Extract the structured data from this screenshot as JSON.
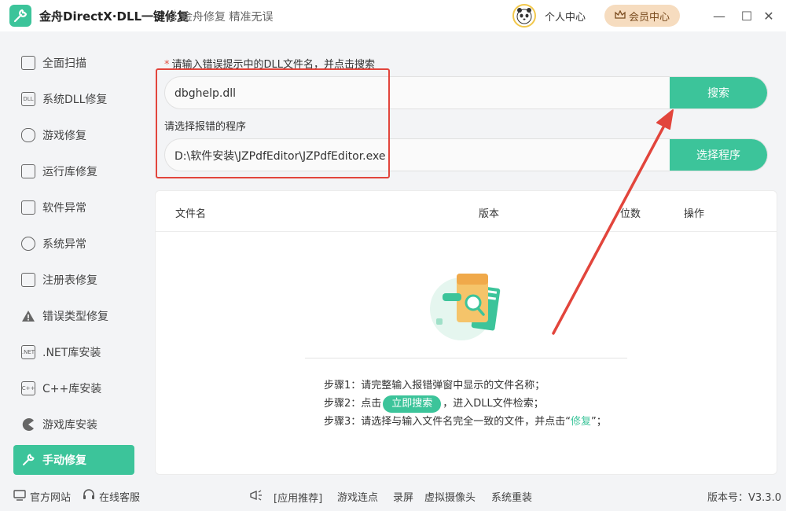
{
  "titlebar": {
    "title": "金舟DirectX·DLL一键修复",
    "slogan": "金舟修复 精准无误",
    "personal_center": "个人中心",
    "vip_center": "会员中心",
    "minimize": "—",
    "maximize": "☐",
    "close": "✕"
  },
  "sidebar": {
    "items": [
      {
        "label": "全面扫描",
        "icon": "scan-icon"
      },
      {
        "label": "系统DLL修复",
        "icon": "dll-icon"
      },
      {
        "label": "游戏修复",
        "icon": "gamepad-icon"
      },
      {
        "label": "运行库修复",
        "icon": "runtime-icon"
      },
      {
        "label": "软件异常",
        "icon": "code-icon"
      },
      {
        "label": "系统异常",
        "icon": "gear-icon"
      },
      {
        "label": "注册表修复",
        "icon": "list-icon"
      },
      {
        "label": "错误类型修复",
        "icon": "warning-icon"
      },
      {
        "label": ".NET库安装",
        "icon": "dotnet-icon"
      },
      {
        "label": "C++库安装",
        "icon": "cpp-icon"
      },
      {
        "label": "游戏库安装",
        "icon": "pacman-icon"
      },
      {
        "label": "手动修复",
        "icon": "wrench-icon",
        "active": true
      }
    ],
    "icon_text": {
      "dll": "DLL",
      "dotnet": ".NET",
      "cpp": "C++"
    }
  },
  "search": {
    "required_star": "*",
    "label": "请输入错误提示中的DLL文件名，并点击搜索",
    "value": "dbghelp.dll",
    "button": "搜索"
  },
  "program": {
    "label": "请选择报错的程序",
    "value": "D:\\软件安装\\JZPdfEditor\\JZPdfEditor.exe",
    "button": "选择程序"
  },
  "table": {
    "columns": [
      "文件名",
      "版本",
      "位数",
      "操作"
    ]
  },
  "steps": {
    "step1": "步骤1：请完整输入报错弹窗中显示的文件名称；",
    "step2_prefix": "步骤2：点击",
    "step2_chip": "立即搜索",
    "step2_suffix": "，进入DLL文件检索；",
    "step3_prefix": "步骤3：请选择与输入文件名完全一致的文件，并点击",
    "step3_quote_open": "“",
    "step3_hl": "修复",
    "step3_quote_close": "”；"
  },
  "footer": {
    "official_site": "官方网站",
    "online_service": "在线客服",
    "app_recommend": "[应用推荐]",
    "links": [
      "游戏连点",
      "录屏",
      "虚拟摄像头",
      "系统重装"
    ],
    "version": "版本号：V3.3.0"
  },
  "colors": {
    "accent": "#3cc49a",
    "annotation_red": "#e2453c",
    "vip_bg": "#f6dcbf"
  }
}
